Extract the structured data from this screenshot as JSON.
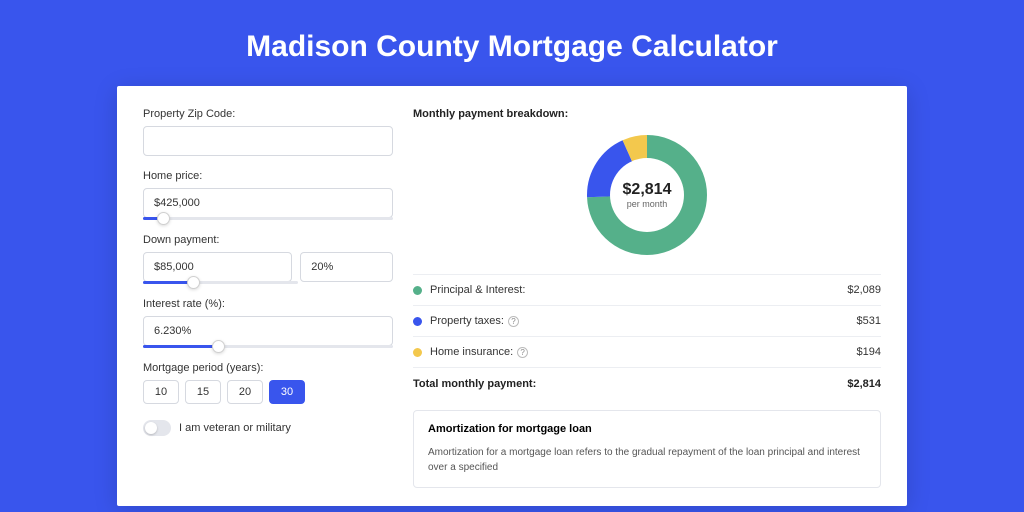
{
  "title": "Madison County Mortgage Calculator",
  "form": {
    "zip": {
      "label": "Property Zip Code:",
      "value": ""
    },
    "home_price": {
      "label": "Home price:",
      "value": "$425,000",
      "slider_pct": 8
    },
    "down_payment": {
      "label": "Down payment:",
      "value": "$85,000",
      "pct": "20%",
      "slider_pct": 20
    },
    "interest_rate": {
      "label": "Interest rate (%):",
      "value": "6.230%",
      "slider_pct": 30
    },
    "period": {
      "label": "Mortgage period (years):",
      "options": [
        "10",
        "15",
        "20",
        "30"
      ],
      "active": "30"
    },
    "veteran": {
      "label": "I am veteran or military",
      "checked": false
    }
  },
  "breakdown": {
    "title": "Monthly payment breakdown:",
    "center_amount": "$2,814",
    "center_sub": "per month",
    "items": [
      {
        "label": "Principal & Interest:",
        "value": "$2,089",
        "color": "#55b08a",
        "help": false
      },
      {
        "label": "Property taxes:",
        "value": "$531",
        "color": "#3955ed",
        "help": true
      },
      {
        "label": "Home insurance:",
        "value": "$194",
        "color": "#f3c84d",
        "help": true
      }
    ],
    "total_label": "Total monthly payment:",
    "total_value": "$2,814"
  },
  "chart_data": {
    "type": "pie",
    "title": "Monthly payment breakdown",
    "series": [
      {
        "name": "Principal & Interest",
        "value": 2089,
        "color": "#55b08a"
      },
      {
        "name": "Property taxes",
        "value": 531,
        "color": "#3955ed"
      },
      {
        "name": "Home insurance",
        "value": 194,
        "color": "#f3c84d"
      }
    ],
    "total": 2814
  },
  "amortization": {
    "title": "Amortization for mortgage loan",
    "text": "Amortization for a mortgage loan refers to the gradual repayment of the loan principal and interest over a specified"
  }
}
